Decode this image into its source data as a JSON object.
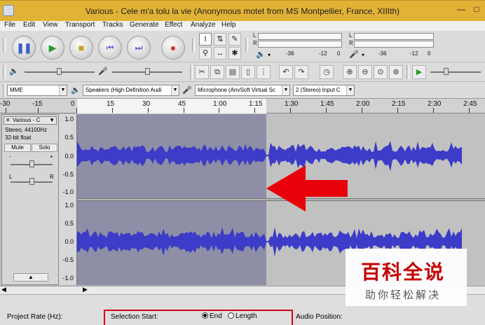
{
  "window": {
    "title": "Various - Cele m'a tolu la vie (Anonymous motet from MS Montpellier, France, XIIIth)",
    "minimize_icon": "minimize-icon",
    "maximize_icon": "maximize-icon"
  },
  "menu": [
    "File",
    "Edit",
    "View",
    "Transport",
    "Tracks",
    "Generate",
    "Effect",
    "Analyze",
    "Help"
  ],
  "transport": {
    "buttons": [
      "pause",
      "play",
      "stop",
      "skip-to-start",
      "skip-to-end",
      "record"
    ]
  },
  "meters": {
    "playback_scale": [
      "-36",
      "-12",
      "0"
    ],
    "record_scale": [
      "-36",
      "-12",
      "0"
    ],
    "meter_left_label": "L",
    "meter_right_label": "R",
    "record_meter_left_label": "L",
    "record_meter_right_label": "R"
  },
  "devices": {
    "host": "MME",
    "output": "Speakers (High Definition Audi",
    "input": "Microphone (AnvSoft Virtual Sc",
    "channels": "2 (Stereo) Input C"
  },
  "timeline": {
    "labels": [
      "-30",
      "-15",
      "0",
      "15",
      "30",
      "45",
      "1:00",
      "1:15",
      "1:30",
      "1:45",
      "2:00",
      "2:15",
      "2:30",
      "2:45"
    ]
  },
  "track": {
    "name": "Various - C",
    "format_rate": "Stereo, 44100Hz",
    "format_bits": "32-bit float",
    "mute_label": "Mute",
    "solo_label": "Solo",
    "gain_minus": "-",
    "gain_plus": "+",
    "pan_left": "L",
    "pan_right": "R",
    "channel1_scale": [
      "1.0",
      "0.5",
      "0.0",
      "-0.5",
      "-1.0"
    ],
    "channel2_scale": [
      "1.0",
      "0.5",
      "0.0",
      "-0.5",
      "-1.0"
    ]
  },
  "selection_toolbar": {
    "project_rate_label": "Project Rate (Hz):",
    "selection_start_label": "Selection Start:",
    "end_label": "End",
    "length_label": "Length",
    "end_selected": true,
    "audio_position_label": "Audio Position:"
  },
  "watermark": {
    "title": "百科全说",
    "subtitle": "助你轻松解决"
  },
  "colors": {
    "waveform": "#3c3cc8",
    "selection": "#8e8ea6",
    "annotation_arrow": "#e8000b",
    "title_bar": "#e2b236"
  }
}
